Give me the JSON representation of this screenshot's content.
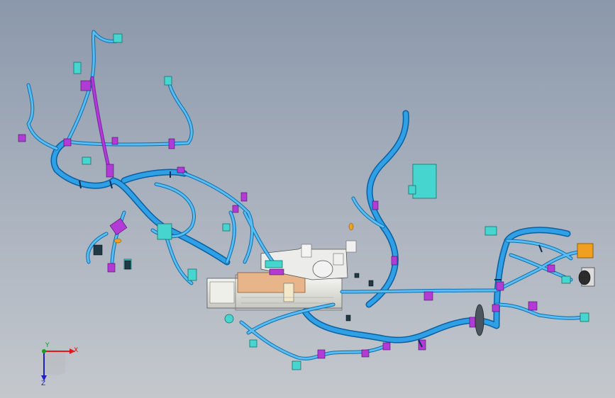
{
  "viewport": {
    "background_top": "#8b98ab",
    "background_bottom": "#c4c8cd"
  },
  "colors": {
    "harness": "#1e8fdc",
    "harness_light": "#56b8ef",
    "harness_dark": "#0b5f9e",
    "clip": "#b23bd6",
    "connector": "#46d6cf",
    "connector_orange": "#f0a020",
    "module_body": "#e8e8e4",
    "module_copper": "#e8b48a"
  },
  "triad": {
    "x_label": "X",
    "y_label": "Y",
    "z_label": "Z",
    "x_color": "#e01818",
    "y_color": "#18a018",
    "z_color": "#2020c0"
  }
}
